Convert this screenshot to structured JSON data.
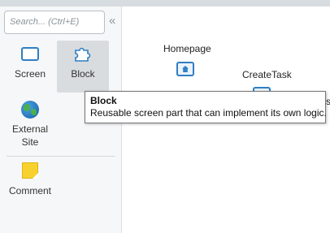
{
  "search": {
    "placeholder": "Search... (Ctrl+E)"
  },
  "toolbox": {
    "collapse_glyph": "«",
    "items": [
      {
        "label": "Screen",
        "icon": "screen-icon"
      },
      {
        "label": "Block",
        "icon": "block-icon"
      },
      {
        "label": "External Site",
        "label_line1": "External",
        "label_line2": "Site",
        "icon": "globe-icon"
      },
      {
        "label": "Comment",
        "icon": "sticky-note-icon"
      }
    ]
  },
  "canvas": {
    "nodes": [
      {
        "label": "Homepage",
        "icon": "home-screen-icon"
      },
      {
        "label": "CreateTask",
        "icon": "screen-icon"
      }
    ],
    "clipped_text": "s"
  },
  "tooltip": {
    "title": "Block",
    "description": "Reusable screen part that can implement its own logic."
  },
  "colors": {
    "accent": "#2f7fc4",
    "toolbox_bg": "#f6f7f8",
    "selected_tile_bg": "#d9dcdf",
    "comment_yellow": "#f7d22e"
  }
}
